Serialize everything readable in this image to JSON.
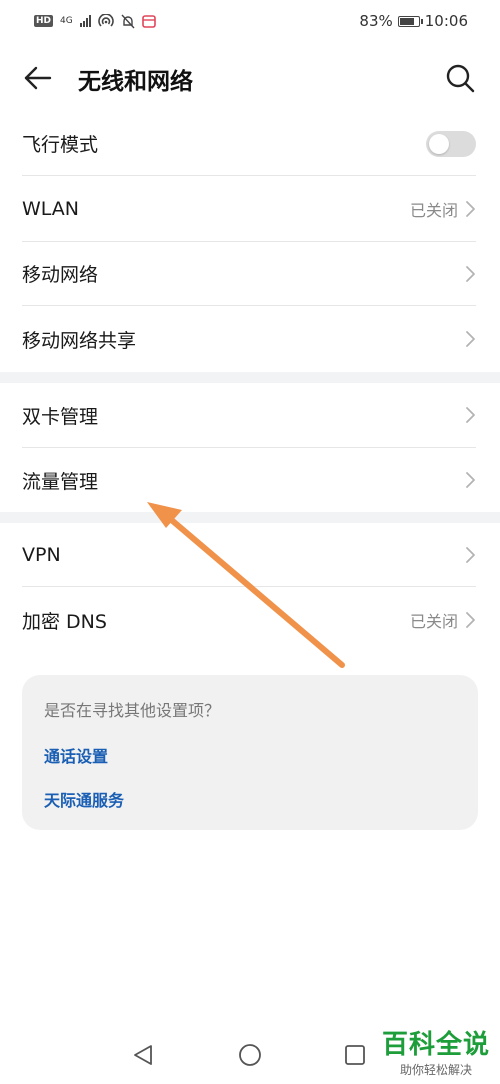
{
  "status_bar": {
    "network": "4G",
    "battery_text": "83%",
    "battery_level": 0.83,
    "time": "10:06"
  },
  "header": {
    "title": "无线和网络"
  },
  "rows": {
    "airplane": {
      "label": "飞行模式",
      "toggle_on": false
    },
    "wlan": {
      "label": "WLAN",
      "value": "已关闭"
    },
    "mobile_network": {
      "label": "移动网络"
    },
    "hotspot": {
      "label": "移动网络共享"
    },
    "dual_sim": {
      "label": "双卡管理"
    },
    "data_usage": {
      "label": "流量管理"
    },
    "vpn": {
      "label": "VPN"
    },
    "private_dns": {
      "label": "加密 DNS",
      "value": "已关闭"
    }
  },
  "suggestions": {
    "question": "是否在寻找其他设置项？",
    "links": [
      "通话设置",
      "天际通服务"
    ]
  },
  "watermark": {
    "main": "百科全说",
    "sub": "助你轻松解决"
  },
  "colors": {
    "accent_link": "#1a5fb4",
    "arrow": "#f0924a",
    "watermark_green": "#1e9e3a"
  },
  "icons": [
    "back-arrow-icon",
    "search-icon",
    "chevron-right-icon",
    "nav-back-icon",
    "nav-home-icon",
    "nav-recent-icon"
  ]
}
